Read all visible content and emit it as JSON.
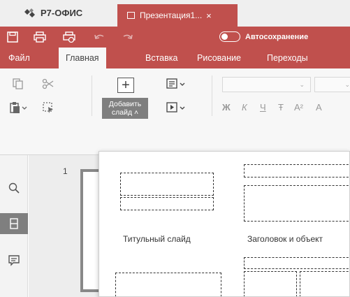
{
  "app": {
    "name": "Р7-ОФИС",
    "document_tab": "Презентация1...",
    "tab_close": "×"
  },
  "quick_access": {
    "autosave_label": "Автосохранение",
    "autosave_on": true
  },
  "menu": {
    "tabs": [
      "Файл",
      "Главная",
      "Вставка",
      "Рисование",
      "Переходы"
    ],
    "active": "Главная"
  },
  "toolbar": {
    "add_slide_label": "Добавить слайд ˄",
    "format_buttons": [
      "Ж",
      "К",
      "Ч",
      "Ŧ",
      "A²",
      "A"
    ]
  },
  "sidebar": {
    "items": [
      "search-icon",
      "slides-icon",
      "comments-icon"
    ],
    "active": "slides-icon"
  },
  "thumbnails": {
    "slide_number": "1"
  },
  "layouts": {
    "items": [
      {
        "name": "Титульный слайд"
      },
      {
        "name": "Заголовок и объект"
      }
    ]
  },
  "colors": {
    "accent": "#c0504d",
    "active_gray": "#7f7f7f"
  }
}
